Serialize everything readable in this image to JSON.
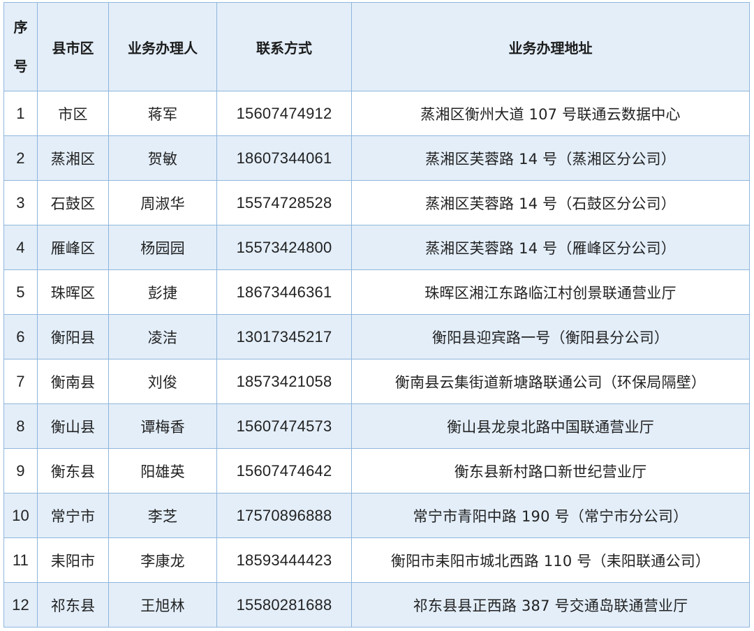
{
  "table": {
    "headers": {
      "seq_line1": "序",
      "seq_line2": "号",
      "county": "县市区",
      "handler": "业务办理人",
      "contact": "联系方式",
      "address": "业务办理地址"
    },
    "rows": [
      {
        "no": "1",
        "county": "市区",
        "handler": "蒋军",
        "phone": "15607474912",
        "address": "蒸湘区衡州大道 107 号联通云数据中心"
      },
      {
        "no": "2",
        "county": "蒸湘区",
        "handler": "贺敏",
        "phone": "18607344061",
        "address": "蒸湘区芙蓉路 14 号（蒸湘区分公司）"
      },
      {
        "no": "3",
        "county": "石鼓区",
        "handler": "周淑华",
        "phone": "15574728528",
        "address": "蒸湘区芙蓉路 14 号（石鼓区分公司）"
      },
      {
        "no": "4",
        "county": "雁峰区",
        "handler": "杨园园",
        "phone": "15573424800",
        "address": "蒸湘区芙蓉路 14 号（雁峰区分公司）"
      },
      {
        "no": "5",
        "county": "珠晖区",
        "handler": "彭捷",
        "phone": "18673446361",
        "address": "珠晖区湘江东路临江村创景联通营业厅"
      },
      {
        "no": "6",
        "county": "衡阳县",
        "handler": "凌洁",
        "phone": "13017345217",
        "address": "衡阳县迎宾路一号（衡阳县分公司）"
      },
      {
        "no": "7",
        "county": "衡南县",
        "handler": "刘俊",
        "phone": "18573421058",
        "address": "衡南县云集街道新塘路联通公司（环保局隔壁）"
      },
      {
        "no": "8",
        "county": "衡山县",
        "handler": "谭梅香",
        "phone": "15607474573",
        "address": "衡山县龙泉北路中国联通营业厅"
      },
      {
        "no": "9",
        "county": "衡东县",
        "handler": "阳雄英",
        "phone": "15607474642",
        "address": "衡东县新村路口新世纪营业厅"
      },
      {
        "no": "10",
        "county": "常宁市",
        "handler": "李芝",
        "phone": "17570896888",
        "address": "常宁市青阳中路 190 号（常宁市分公司）"
      },
      {
        "no": "11",
        "county": "耒阳市",
        "handler": "李康龙",
        "phone": "18593444423",
        "address": "衡阳市耒阳市城北西路 110 号（耒阳联通公司）"
      },
      {
        "no": "12",
        "county": "祁东县",
        "handler": "王旭林",
        "phone": "15580281688",
        "address": "祁东县县正西路 387 号交通岛联通营业厅"
      }
    ]
  },
  "colors": {
    "border": "#8fb6dc",
    "stripe": "#e3eef9",
    "text": "#222222"
  }
}
